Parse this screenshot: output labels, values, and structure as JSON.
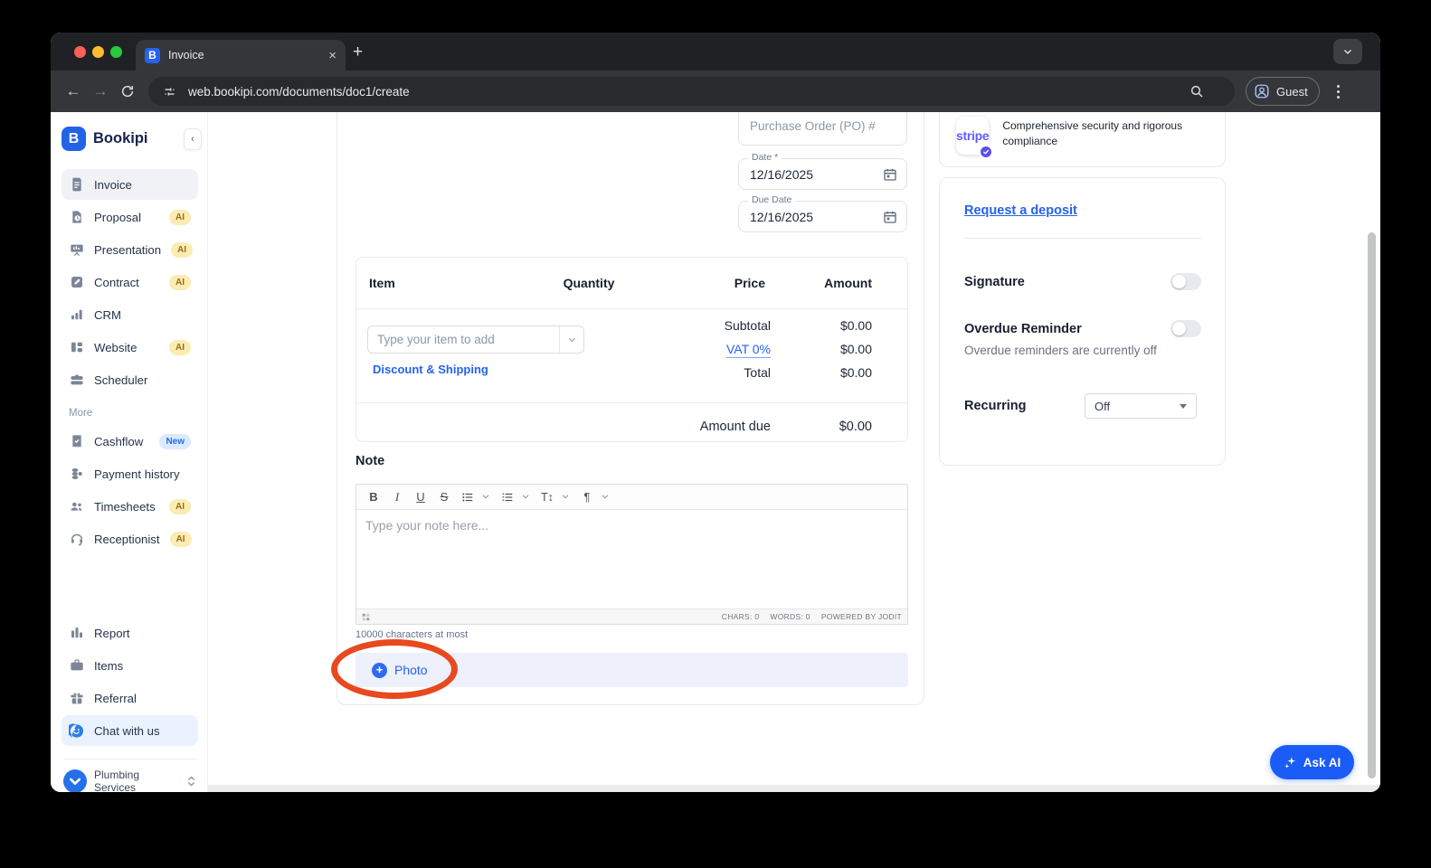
{
  "browser": {
    "tab_title": "Invoice",
    "url": "web.bookipi.com/documents/doc1/create",
    "profile_label": "Guest",
    "new_tab_label": "+",
    "close_tab_label": "×"
  },
  "sidebar": {
    "brand": "Bookipi",
    "collapse_glyph": "‹",
    "items": [
      {
        "label": "Invoice",
        "badge": ""
      },
      {
        "label": "Proposal",
        "badge": "AI"
      },
      {
        "label": "Presentation",
        "badge": "AI"
      },
      {
        "label": "Contract",
        "badge": "AI"
      },
      {
        "label": "CRM",
        "badge": ""
      },
      {
        "label": "Website",
        "badge": "AI"
      },
      {
        "label": "Scheduler",
        "badge": ""
      }
    ],
    "more_label": "More",
    "more_items": [
      {
        "label": "Cashflow",
        "badge": "New"
      },
      {
        "label": "Payment history",
        "badge": ""
      },
      {
        "label": "Timesheets",
        "badge": "AI"
      },
      {
        "label": "Receptionist",
        "badge": "AI"
      }
    ],
    "bottom_items": [
      {
        "label": "Report"
      },
      {
        "label": "Items"
      },
      {
        "label": "Referral"
      },
      {
        "label": "Chat with us"
      }
    ],
    "org_name": "Plumbing Services"
  },
  "invoice": {
    "po_placeholder": "Purchase Order (PO) #",
    "date": {
      "label": "Date *",
      "value": "12/16/2025"
    },
    "due_date": {
      "label": "Due Date",
      "value": "12/16/2025"
    },
    "table": {
      "headers": [
        "Item",
        "Quantity",
        "Price",
        "Amount"
      ],
      "item_input_placeholder": "Type your item to add",
      "discount_link": "Discount & Shipping",
      "totals": [
        {
          "label": "Subtotal",
          "value": "$0.00"
        },
        {
          "label": "VAT 0%",
          "value": "$0.00"
        },
        {
          "label": "Total",
          "value": "$0.00"
        }
      ],
      "amount_due": {
        "label": "Amount due",
        "value": "$0.00"
      }
    },
    "note": {
      "title": "Note",
      "placeholder": "Type your note here...",
      "chars": "CHARS: 0",
      "words": "WORDS: 0",
      "powered": "POWERED BY JODIT",
      "limit": "10000 characters at most"
    },
    "photo_button": "Photo"
  },
  "panel": {
    "stripe_brand": "stripe",
    "stripe_text": "Comprehensive security and rigorous compliance",
    "deposit_link": "Request a deposit",
    "signature_label": "Signature",
    "overdue_label": "Overdue Reminder",
    "overdue_subtext": "Overdue reminders are currently off",
    "recurring_label": "Recurring",
    "recurring_value": "Off"
  },
  "ask_ai_label": "Ask AI",
  "colors": {
    "accent_blue": "#2563eb",
    "bookipi_blue": "#2264e5",
    "stripe_purple": "#635bff",
    "annotation_red": "#e8491f",
    "ai_badge_bg": "#fbecb2",
    "new_badge_bg": "#dceafe"
  }
}
